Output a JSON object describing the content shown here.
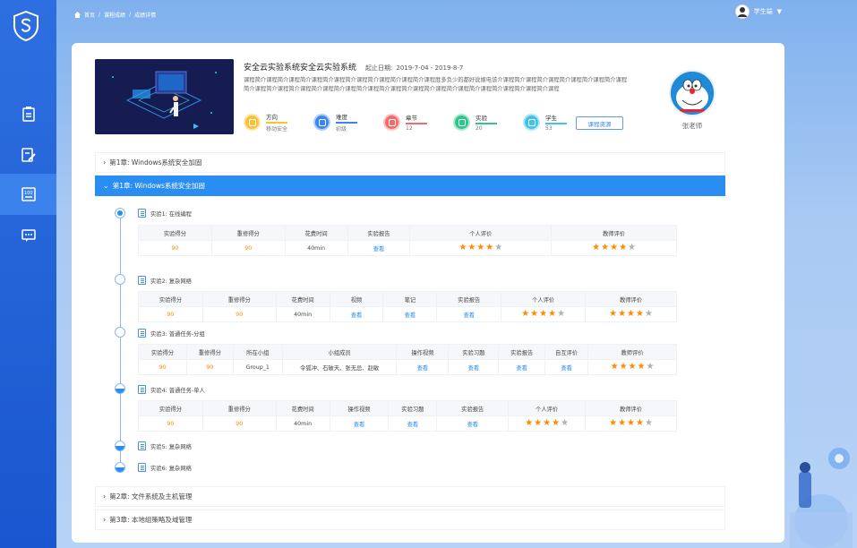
{
  "breadcrumb": {
    "home": "首页",
    "sep": "/",
    "item1": "课程成绩",
    "item2": "成绩详情"
  },
  "user": {
    "name": "学生端"
  },
  "course": {
    "title": "安全云实验系统安全云实验系统",
    "date_label": "起止日期:",
    "date_value": "2019-7-04  -  2019-8-7",
    "description": "课程简介课程简介课程简介课程简介课程简介课程简介课程简介课程简介课程胜多负少的都好说嫁电该介课程简介课程简介课程简介课程简介课程简介课程简介课程简介课程简介课程简介课程简介课程简介课程简介课程简介课程简介课程简介课程简介课程简介课程简介课程简介课程",
    "resource_button": "课程资源",
    "teacher_name": "张老师",
    "stats": [
      {
        "label": "方向",
        "value": "移动安全",
        "color": "#f9c134"
      },
      {
        "label": "难度",
        "value": "初级",
        "color": "#3a86ee"
      },
      {
        "label": "章节",
        "value": "12",
        "color": "#f26b6b"
      },
      {
        "label": "实验",
        "value": "20",
        "color": "#2dc58c"
      },
      {
        "label": "学生",
        "value": "53",
        "color": "#3fc3e8"
      }
    ]
  },
  "chapters": {
    "top_label": "第1章: Windows系统安全加固",
    "active_label": "第1章: Windows系统安全加固",
    "bottom": [
      {
        "label": "第2章: 文件系统及主机管理"
      },
      {
        "label": "第3章: 本地组策略及域管理"
      }
    ]
  },
  "experiments": [
    {
      "title": "实验1: 在线编程",
      "headers": [
        "实验得分",
        "重修得分",
        "花费时间",
        "实验报告",
        "个人评价",
        "教师评价"
      ],
      "row": [
        "90",
        "90",
        "40min",
        "查看"
      ],
      "personal_rating": 4,
      "teacher_rating": 4
    },
    {
      "title": "实验2: 复杂网络",
      "headers": [
        "实验得分",
        "重修得分",
        "花费时间",
        "视频",
        "笔记",
        "实验报告",
        "个人评价",
        "教师评价"
      ],
      "row": [
        "90",
        "90",
        "40min",
        "查看",
        "查看",
        "查看"
      ],
      "personal_rating": 4,
      "teacher_rating": 4
    },
    {
      "title": "实验3: 普通任务-分组",
      "headers": [
        "实验得分",
        "重修得分",
        "所在小组",
        "小组成员",
        "操作视频",
        "实验习题",
        "实验报告",
        "自互评价",
        "教师评价"
      ],
      "row": [
        "90",
        "90",
        "Group_1",
        "令狐冲、石破天、张无忌、赵敏",
        "查看",
        "查看",
        "查看",
        "查看"
      ],
      "teacher_rating": 4
    },
    {
      "title": "实验4: 普通任务-单人",
      "headers": [
        "实验得分",
        "重修得分",
        "花费时间",
        "操作视频",
        "实验习题",
        "实验报告",
        "个人评价",
        "教师评价"
      ],
      "row": [
        "90",
        "90",
        "40min",
        "查看",
        "查看",
        "查看"
      ],
      "personal_rating": 4,
      "teacher_rating": 4
    },
    {
      "title": "实验5: 复杂网络"
    },
    {
      "title": "实验6: 复杂网络"
    }
  ]
}
